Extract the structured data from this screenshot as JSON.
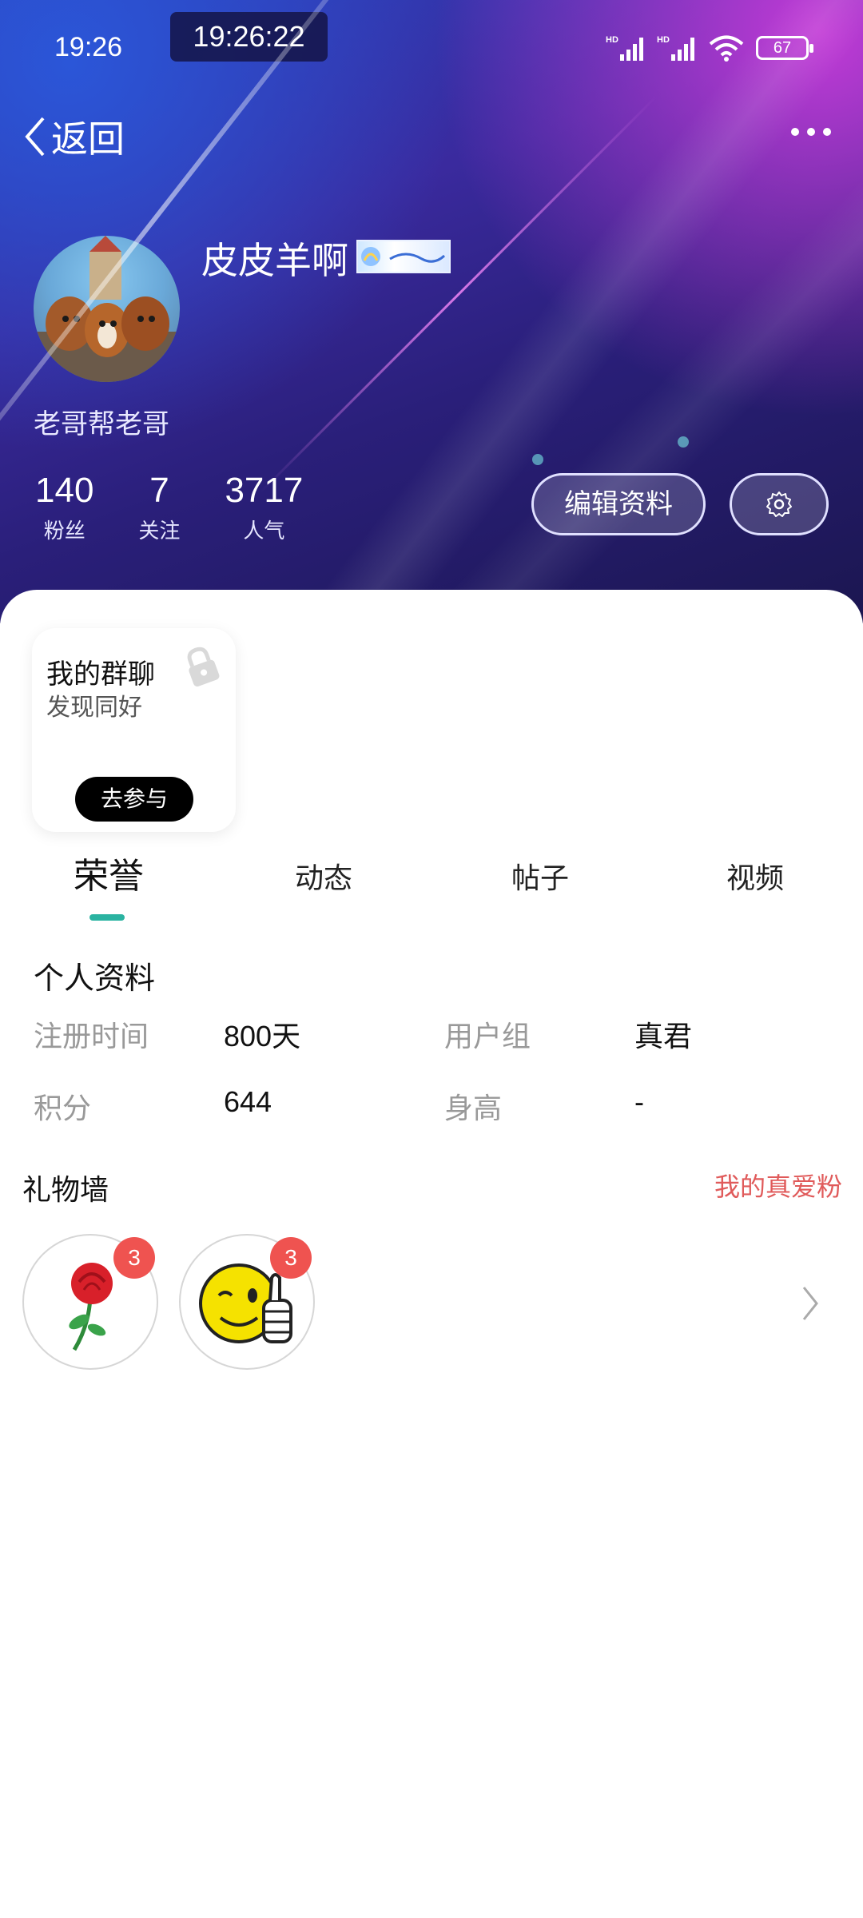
{
  "status_bar": {
    "time": "19:26",
    "clock": "19:26:22",
    "battery": "67"
  },
  "nav": {
    "back_label": "返回"
  },
  "profile": {
    "username": "皮皮羊啊",
    "signature": "老哥帮老哥",
    "stats": [
      {
        "value": "140",
        "label": "粉丝"
      },
      {
        "value": "7",
        "label": "关注"
      },
      {
        "value": "3717",
        "label": "人气"
      }
    ],
    "edit_label": "编辑资料"
  },
  "group_card": {
    "title": "我的群聊",
    "subtitle": "发现同好",
    "button": "去参与"
  },
  "tabs": [
    "荣誉",
    "动态",
    "帖子",
    "视频"
  ],
  "personal_info": {
    "title": "个人资料",
    "rows": [
      {
        "label1": "注册时间",
        "value1": "800天",
        "label2": "用户组",
        "value2": "真君"
      },
      {
        "label1": "积分",
        "value1": "644",
        "label2": "身高",
        "value2": "-"
      }
    ]
  },
  "gift_wall": {
    "title": "礼物墙",
    "link": "我的真爱粉",
    "gifts": [
      {
        "icon": "rose-icon",
        "count": "3"
      },
      {
        "icon": "thumbs-up-smiley-icon",
        "count": "3"
      }
    ]
  },
  "colors": {
    "accent_tab": "#2ab3a1",
    "link_red": "#e05a5a",
    "badge_red": "#ef5350"
  }
}
